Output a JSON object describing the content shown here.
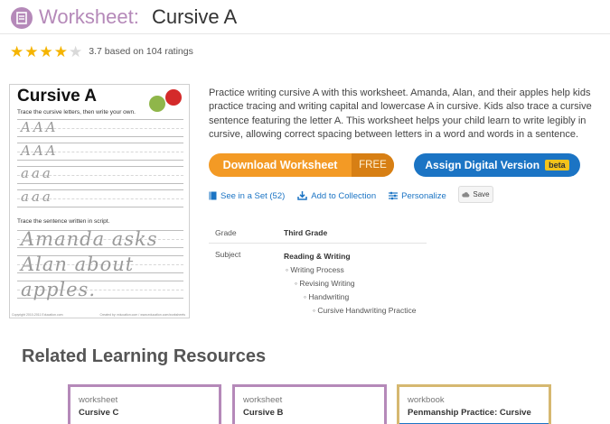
{
  "header": {
    "logo_icon": "worksheet-icon",
    "type_label": "Worksheet:",
    "name": "Cursive A",
    "accent_color": "#b589b9"
  },
  "rating": {
    "value": 3.7,
    "stars_filled": 4,
    "stars_total": 5,
    "text": "3.7 based on 104 ratings"
  },
  "preview": {
    "title": "Cursive A",
    "instruction_1": "Trace the cursive letters, then write your own.",
    "instruction_2": "Trace the sentence written in script.",
    "rows": [
      "AAA",
      "AAA",
      "aaa",
      "aaa"
    ],
    "sentence_lines": [
      "Amanda asks",
      "Alan about",
      "apples."
    ],
    "footer_left": "Copyright 2010-2011 Education.com",
    "footer_right": "Created by: education.com / www.education.com/worksheets"
  },
  "description": "Practice writing cursive A with this worksheet. Amanda, Alan, and their apples help kids practice tracing and writing capital and lowercase A in cursive. Kids also trace a cursive sentence featuring the letter A. This worksheet helps your child learn to write legibly in cursive, allowing correct spacing between letters in a word and words in a sentence.",
  "buttons": {
    "download_label": "Download Worksheet",
    "download_price": "FREE",
    "assign_label": "Assign Digital Version",
    "assign_badge": "beta"
  },
  "actions": {
    "see_in_set": "See in a Set (52)",
    "add_to_collection": "Add to Collection",
    "personalize": "Personalize",
    "save": "Save"
  },
  "meta": {
    "grade_label": "Grade",
    "grade_value": "Third Grade",
    "subject_label": "Subject",
    "subject_tree": [
      "Reading & Writing",
      "Writing Process",
      "Revising Writing",
      "Handwriting",
      "Cursive Handwriting Practice"
    ]
  },
  "related": {
    "title": "Related Learning Resources",
    "cards": [
      {
        "type": "worksheet",
        "name": "Cursive C"
      },
      {
        "type": "worksheet",
        "name": "Cursive B"
      },
      {
        "type": "workbook",
        "name": "Penmanship Practice: Cursive"
      }
    ]
  },
  "colors": {
    "orange": "#f39a25",
    "blue": "#1b74c4",
    "gold": "#d6b870",
    "purple": "#b589b9"
  }
}
